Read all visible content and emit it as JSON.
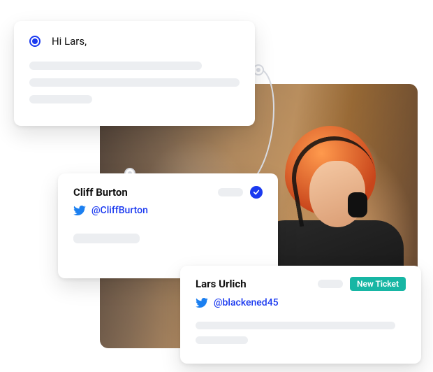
{
  "greeting_card": {
    "text": "Hi Lars,"
  },
  "contact_card_1": {
    "name": "Cliff Burton",
    "handle": "@CliffBurton",
    "verified": true
  },
  "contact_card_2": {
    "name": "Lars Urlich",
    "handle": "@blackened45",
    "badge": "New Ticket"
  }
}
